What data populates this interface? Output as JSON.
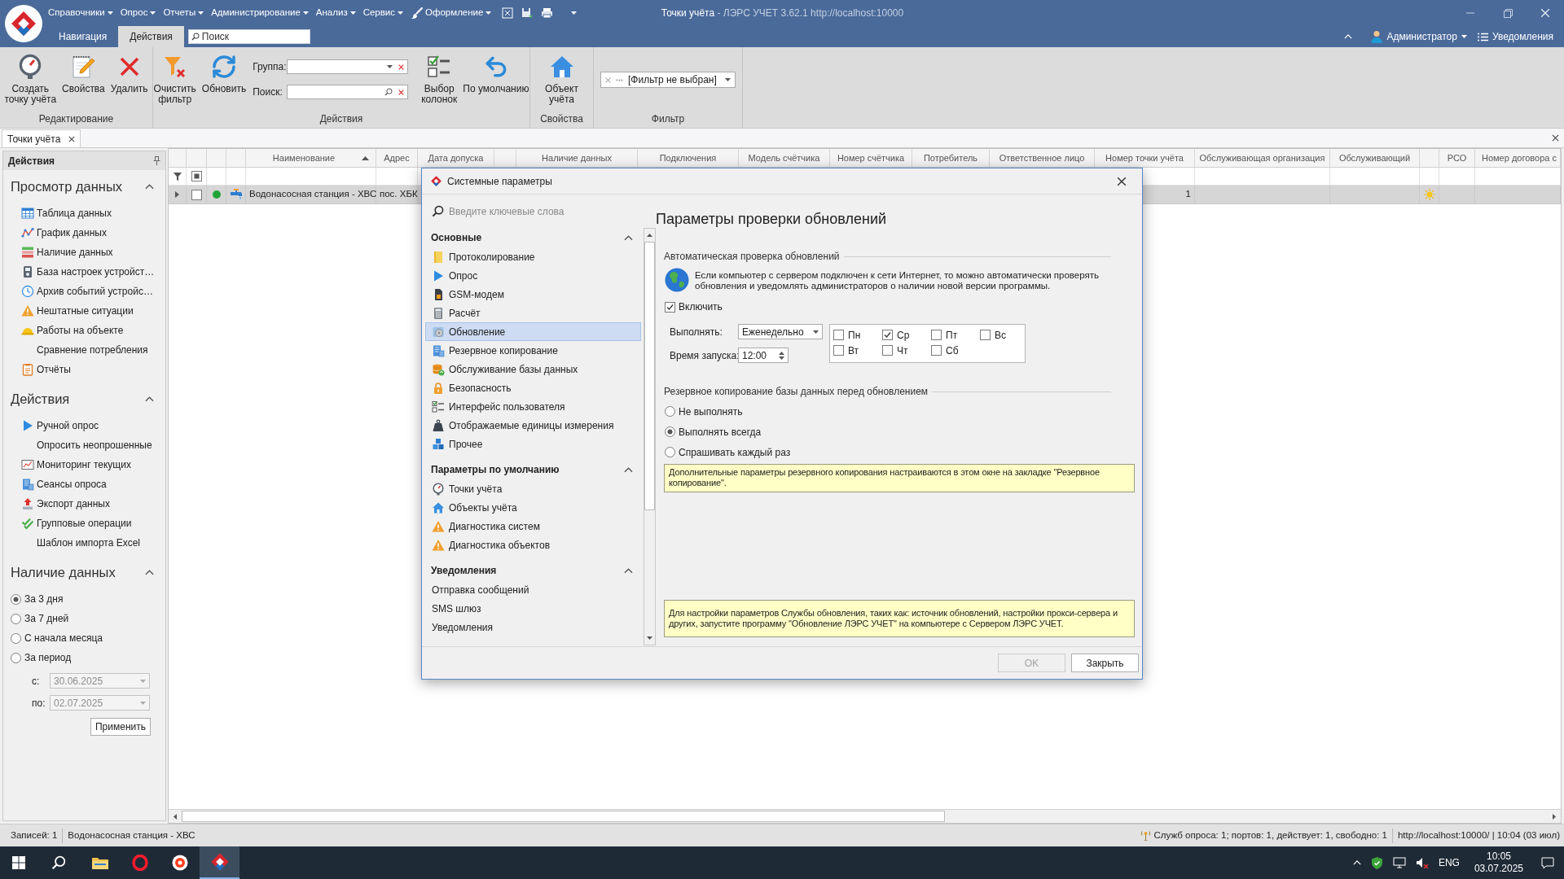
{
  "window": {
    "title": "Точки учёта",
    "subtitle": "- ЛЭРС УЧЕТ 3.62.1 http://localhost:10000"
  },
  "menu": [
    {
      "label": "Справочники",
      "kind": "menu"
    },
    {
      "label": "Опрос",
      "kind": "menu"
    },
    {
      "label": "Отчеты",
      "kind": "menu"
    },
    {
      "label": "Администрирование",
      "kind": "menu"
    },
    {
      "label": "Анализ",
      "kind": "menu"
    },
    {
      "label": "Сервис",
      "kind": "menu"
    },
    {
      "label": "Оформление",
      "kind": "icon-menu"
    }
  ],
  "ribbon_tabs": [
    {
      "label": "Навигация",
      "selected": false
    },
    {
      "label": "Действия",
      "selected": true
    }
  ],
  "quick_search": {
    "placeholder": "Поиск"
  },
  "user": {
    "name": "Администратор"
  },
  "notifications": {
    "label": "Уведомления"
  },
  "ribbon": {
    "groups": [
      {
        "label": "Редактирование",
        "buttons": [
          {
            "label": "Создать\nточку учёта"
          },
          {
            "label": "Свойства"
          },
          {
            "label": "Удалить"
          }
        ]
      },
      {
        "label": "Действия",
        "buttons": [
          {
            "label": "Очистить\nфильтр"
          },
          {
            "label": "Обновить"
          }
        ],
        "fields": [
          {
            "label": "Группа:",
            "kind": "combo"
          },
          {
            "label": "Поиск:",
            "kind": "search"
          }
        ],
        "more_buttons": [
          {
            "label": "Выбор\nколонок"
          },
          {
            "label": "По умолчанию"
          }
        ]
      },
      {
        "label": "Свойства",
        "buttons": [
          {
            "label": "Объект\nучёта"
          }
        ]
      },
      {
        "label": "Фильтр",
        "filter": {
          "value": "[Фильтр не выбран]"
        }
      }
    ]
  },
  "document_tabs": [
    {
      "label": "Точки учёта",
      "selected": true
    }
  ],
  "sidebar": {
    "title": "Действия",
    "sections": [
      {
        "title": "Просмотр данных",
        "expanded": true,
        "items": [
          "Таблица данных",
          "График данных",
          "Наличие данных",
          "База настроек устройст…",
          "Архив событий устройс…",
          "Нештатные ситуации",
          "Работы на объекте",
          "Сравнение потребления",
          "Отчёты"
        ]
      },
      {
        "title": "Действия",
        "expanded": true,
        "items": [
          "Ручной опрос",
          "Опросить неопрошенные",
          "Мониторинг текущих",
          "Сеансы опроса",
          "Экспорт данных",
          "Групповые операции",
          "Шаблон импорта Excel"
        ]
      },
      {
        "title": "Наличие данных",
        "expanded": true,
        "periods": [
          {
            "label": "За 3 дня",
            "selected": true
          },
          {
            "label": "За 7 дней",
            "selected": false
          },
          {
            "label": "С начала месяца",
            "selected": false
          },
          {
            "label": "За период",
            "selected": false
          }
        ],
        "dates": [
          {
            "label": "с:",
            "value": "30.06.2025",
            "disabled": true
          },
          {
            "label": "по:",
            "value": "02.07.2025",
            "disabled": true
          }
        ],
        "apply": "Применить"
      }
    ]
  },
  "grid": {
    "columns": [
      {
        "kind": "blank",
        "sorted": false
      },
      {
        "kind": "blank",
        "sorted": false
      },
      {
        "kind": "blank",
        "sorted": false
      },
      {
        "kind": "blank",
        "sorted": false
      },
      {
        "kind": "text",
        "label": "Наименование",
        "sorted": true
      },
      {
        "kind": "text",
        "label": "Адрес",
        "sorted": false
      },
      {
        "kind": "text",
        "label": "Дата допуска",
        "sorted": false
      },
      {
        "kind": "blank",
        "sorted": false
      },
      {
        "kind": "text",
        "label": "Наличие данных",
        "sorted": false
      },
      {
        "kind": "text",
        "label": "Подключения",
        "sorted": false
      },
      {
        "kind": "text",
        "label": "Модель счётчика",
        "sorted": false
      },
      {
        "kind": "text",
        "label": "Номер счётчика",
        "sorted": false
      },
      {
        "kind": "text",
        "label": "Потребитель",
        "sorted": false
      },
      {
        "kind": "text",
        "label": "Ответственное лицо",
        "sorted": false
      },
      {
        "kind": "text",
        "label": "Номер точки учёта",
        "sorted": false
      },
      {
        "kind": "text",
        "label": "Обслуживающая организация",
        "sorted": false
      },
      {
        "kind": "text",
        "label": "Обслуживающий",
        "sorted": false
      },
      {
        "kind": "blank",
        "sorted": false
      },
      {
        "kind": "text",
        "label": "РСО",
        "sorted": false
      },
      {
        "kind": "text",
        "label": "Номер договора с",
        "sorted": false
      }
    ],
    "select_all": {
      "indeterminate": true
    },
    "rows": [
      {
        "selected": true,
        "expanded": false,
        "checked": false,
        "color": "#22a33a",
        "name": "Водонасосная станция - ХВС",
        "address": "пос. ХБК",
        "point_number": "1"
      }
    ]
  },
  "dialog": {
    "title": "Системные параметры",
    "search": {
      "placeholder": "Введите ключевые слова"
    },
    "nav": [
      {
        "title": "Основные",
        "expanded": true,
        "items": [
          {
            "label": "Протоколирование",
            "selected": false
          },
          {
            "label": "Опрос",
            "selected": false
          },
          {
            "label": "GSM-модем",
            "selected": false
          },
          {
            "label": "Расчёт",
            "selected": false
          },
          {
            "label": "Обновление",
            "selected": true
          },
          {
            "label": "Резервное копирование",
            "selected": false
          },
          {
            "label": "Обслуживание базы данных",
            "selected": false
          },
          {
            "label": "Безопасность",
            "selected": false
          },
          {
            "label": "Интерфейс пользователя",
            "selected": false
          },
          {
            "label": "Отображаемые единицы измерения",
            "selected": false
          },
          {
            "label": "Прочее",
            "selected": false
          }
        ]
      },
      {
        "title": "Параметры по умолчанию",
        "expanded": true,
        "items": [
          {
            "label": "Точки учёта",
            "selected": false
          },
          {
            "label": "Объекты учёта",
            "selected": false
          },
          {
            "label": "Диагностика систем",
            "selected": false
          },
          {
            "label": "Диагностика объектов",
            "selected": false
          }
        ]
      },
      {
        "title": "Уведомления",
        "expanded": true,
        "items": [
          {
            "label": "Отправка сообщений",
            "selected": false
          },
          {
            "label": "SMS шлюз",
            "selected": false
          },
          {
            "label": "Уведомления",
            "selected": false
          }
        ]
      }
    ],
    "page": {
      "title": "Параметры проверки обновлений",
      "auto_check": {
        "title": "Автоматическая проверка обновлений",
        "text": "Если компьютер с сервером подключен к сети Интернет, то можно автоматически проверять обновления и уведомлять администраторов о наличии новой версии программы.",
        "enable": {
          "label": "Включить",
          "checked": true
        },
        "schedule": {
          "label": "Выполнять:",
          "value": "Еженедельно"
        },
        "time": {
          "label": "Время запуска:",
          "value": "12:00"
        },
        "days": [
          {
            "label": "Пн",
            "checked": false
          },
          {
            "label": "Вт",
            "checked": false
          },
          {
            "label": "Ср",
            "checked": true
          },
          {
            "label": "Чт",
            "checked": false
          },
          {
            "label": "Пт",
            "checked": false
          },
          {
            "label": "Сб",
            "checked": false
          },
          {
            "label": "Вс",
            "checked": false
          }
        ]
      },
      "backup": {
        "title": "Резервное копирование базы данных перед обновлением",
        "options": [
          {
            "label": "Не выполнять",
            "selected": false
          },
          {
            "label": "Выполнять всегда",
            "selected": true
          },
          {
            "label": "Спрашивать каждый раз",
            "selected": false
          }
        ],
        "note": "Дополнительные параметры резервного копирования настраиваются в этом окне на закладке \"Резервное копирование\"."
      },
      "note": "Для настройки параметров Службы обновления, таких как: источник обновлений, настройки прокси-сервера и других, запустите программу \"Обновление ЛЭРС УЧЕТ\" на компьютере с Сервером ЛЭРС УЧЕТ."
    },
    "buttons": [
      {
        "label": "OK",
        "disabled": true
      },
      {
        "label": "Закрыть",
        "disabled": false
      }
    ]
  },
  "status_bar": {
    "records": "Записей: 1",
    "current": "Водонасосная станция - ХВС",
    "services": "Служб опроса: 1; портов: 1, действует: 1, свободно: 1",
    "server": "http://localhost:10000/ | 10:04 (03 июл)"
  },
  "taskbar": {
    "apps": [
      {
        "selected": false
      },
      {
        "selected": false
      },
      {
        "selected": false
      },
      {
        "selected": true
      }
    ],
    "language": "ENG",
    "time": "10:05",
    "date": "03.07.2025"
  }
}
